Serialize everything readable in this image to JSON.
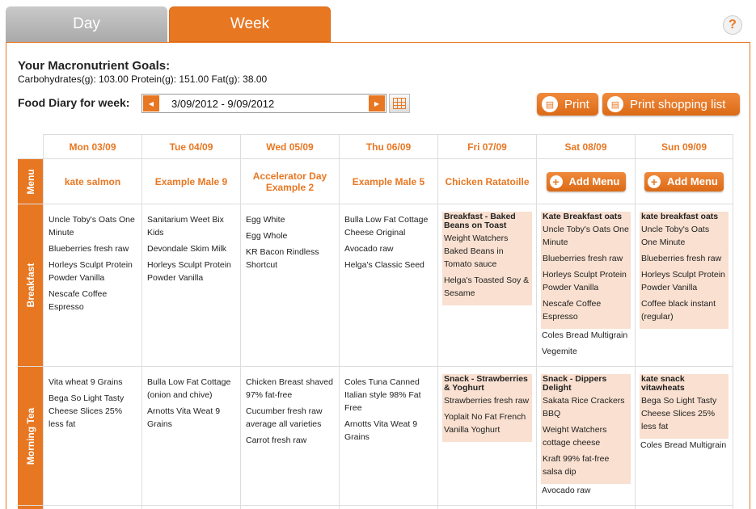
{
  "tabs": {
    "day": "Day",
    "week": "Week"
  },
  "help_label": "?",
  "goals": {
    "title": "Your Macronutrient Goals:",
    "text": "Carbohydrates(g): 103.00 Protein(g): 151.00 Fat(g): 38.00"
  },
  "diary": {
    "label": "Food Diary for week:",
    "range": "3/09/2012 - 9/09/2012"
  },
  "buttons": {
    "print": "Print",
    "shopping": "Print shopping list",
    "add_menu": "Add Menu"
  },
  "row_labels": {
    "menu": "Menu",
    "breakfast": "Breakfast",
    "morning_tea": "Morning Tea"
  },
  "accent_color": "#e87722",
  "days": [
    {
      "header": "Mon 03/09",
      "menu": "kate salmon",
      "breakfast": {
        "title": "",
        "items": [
          "Uncle Toby's Oats One Minute",
          "Blueberries fresh raw",
          "Horleys Sculpt Protein Powder Vanilla",
          "Nescafe Coffee Espresso"
        ]
      },
      "morning_tea": {
        "title": "",
        "items": [
          "Vita wheat 9 Grains",
          "Bega So Light Tasty Cheese Slices 25% less fat"
        ]
      }
    },
    {
      "header": "Tue 04/09",
      "menu": "Example Male 9",
      "breakfast": {
        "title": "",
        "items": [
          "Sanitarium Weet Bix Kids",
          "Devondale Skim Milk",
          "Horleys Sculpt Protein Powder Vanilla"
        ]
      },
      "morning_tea": {
        "title": "",
        "items": [
          "Bulla Low Fat Cottage (onion and chive)",
          "Arnotts Vita Weat 9 Grains"
        ]
      }
    },
    {
      "header": "Wed 05/09",
      "menu": "Accelerator Day Example 2",
      "breakfast": {
        "title": "",
        "items": [
          "Egg White",
          "Egg Whole",
          "KR Bacon Rindless Shortcut"
        ]
      },
      "morning_tea": {
        "title": "",
        "items": [
          "Chicken Breast shaved 97% fat-free",
          "Cucumber fresh raw average all varieties",
          "Carrot fresh raw"
        ]
      }
    },
    {
      "header": "Thu 06/09",
      "menu": "Example Male 5",
      "breakfast": {
        "title": "",
        "items": [
          "Bulla Low Fat Cottage Cheese Original",
          "Avocado raw",
          "Helga's Classic Seed"
        ]
      },
      "morning_tea": {
        "title": "",
        "items": [
          "Coles Tuna Canned Italian style 98% Fat Free",
          "Arnotts Vita Weat 9 Grains"
        ]
      }
    },
    {
      "header": "Fri 07/09",
      "menu": "Chicken Ratatoille",
      "breakfast": {
        "title": "Breakfast - Baked Beans on Toast",
        "items": [
          "Weight Watchers Baked Beans in Tomato sauce",
          "Helga's Toasted Soy & Sesame"
        ]
      },
      "morning_tea": {
        "title": "Snack - Strawberries & Yoghurt",
        "items": [
          "Strawberries fresh raw",
          "Yoplait No Fat French Vanilla Yoghurt"
        ]
      }
    },
    {
      "header": "Sat 08/09",
      "menu": "",
      "breakfast": {
        "title": "Kate Breakfast oats",
        "items": [
          "Uncle Toby's Oats One Minute",
          "Blueberries fresh raw",
          "Horleys Sculpt Protein Powder Vanilla",
          "Nescafe Coffee Espresso"
        ],
        "extra": [
          "Coles Bread Multigrain",
          "Vegemite"
        ]
      },
      "morning_tea": {
        "title": "Snack - Dippers Delight",
        "items": [
          "Sakata Rice Crackers BBQ",
          "Weight Watchers cottage cheese",
          "Kraft 99% fat-free salsa dip"
        ],
        "extra": [
          "Avocado raw"
        ]
      }
    },
    {
      "header": "Sun 09/09",
      "menu": "",
      "breakfast": {
        "title": "kate breakfast oats",
        "items": [
          "Uncle Toby's Oats One Minute",
          "Blueberries fresh raw",
          "Horleys Sculpt Protein Powder Vanilla",
          "Coffee black instant (regular)"
        ]
      },
      "morning_tea": {
        "title": "kate snack vitawheats",
        "items": [
          "Bega So Light Tasty Cheese Slices 25% less fat"
        ],
        "extra": [
          "Coles Bread Multigrain"
        ]
      }
    }
  ]
}
